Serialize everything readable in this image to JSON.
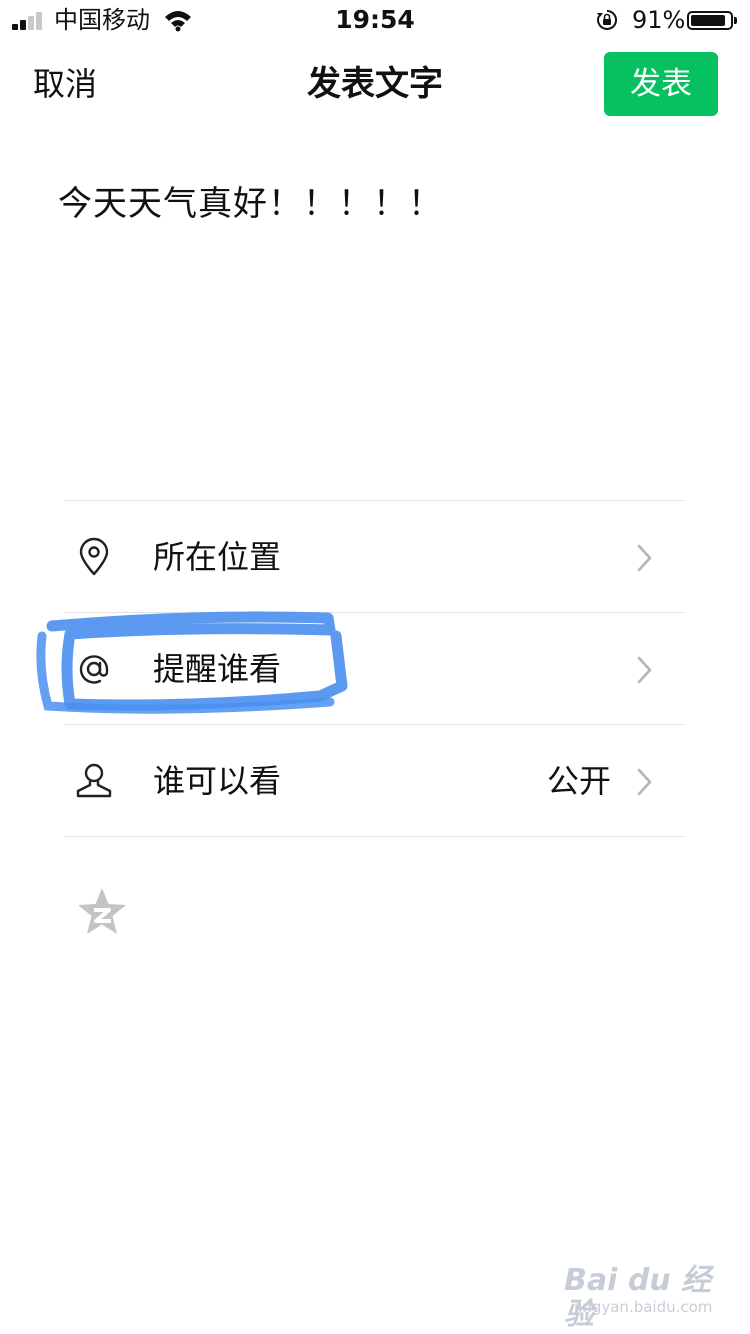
{
  "status_bar": {
    "carrier": "中国移动",
    "time": "19:54",
    "battery_percent": "91%",
    "battery_level": 0.91,
    "signal_bars": 2
  },
  "nav": {
    "cancel_label": "取消",
    "title": "发表文字",
    "post_label": "发表",
    "post_color": "#07c160"
  },
  "post": {
    "text": "今天天气真好！！！！！"
  },
  "options": [
    {
      "label": "所在位置",
      "icon": "location-pin-icon",
      "value": ""
    },
    {
      "label": "提醒谁看",
      "icon": "at-sign-icon",
      "value": ""
    },
    {
      "label": "谁可以看",
      "icon": "person-icon",
      "value": "公开"
    }
  ],
  "annotation": {
    "highlight_color": "#4a8ff0"
  },
  "share": {
    "icon": "qzone-star-icon"
  },
  "watermark": {
    "main": "Bai du 经验",
    "sub": "jingyan.baidu.com"
  }
}
